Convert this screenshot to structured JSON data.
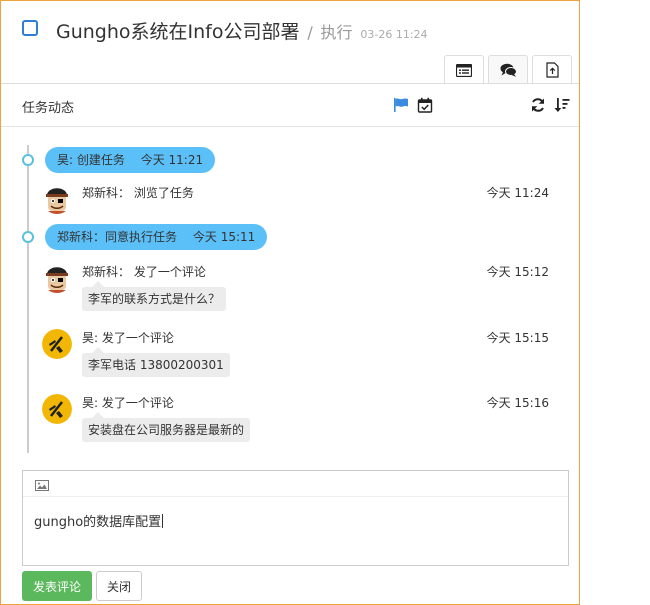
{
  "task": {
    "title": "Gungho系统在Info公司部署",
    "separator": "/",
    "status": "执行",
    "timestamp": "03-26 11:24"
  },
  "tabs": [
    {
      "icon": "list-icon",
      "active": false
    },
    {
      "icon": "comments-icon",
      "active": true
    },
    {
      "icon": "file-upload-icon",
      "active": false
    }
  ],
  "toolbar": {
    "title": "任务动态",
    "icons": [
      "flag-icon",
      "calendar-check-icon",
      "refresh-icon",
      "sort-icon"
    ],
    "flag_color": "#3b8be0"
  },
  "events": [
    {
      "actor": "昊",
      "action": "创建任务",
      "time": "今天 11:21"
    },
    {
      "actor": "郑新科",
      "action": "同意执行任务",
      "time": "今天 15:11"
    }
  ],
  "entries": [
    {
      "who": "郑新科：  浏览了任务",
      "time": "今天 11:24",
      "comment": "",
      "avatar": "pirate-avatar"
    },
    {
      "who": "郑新科：  发了一个评论",
      "time": "今天 15:12",
      "comment": "李军的联系方式是什么？",
      "avatar": "pirate-avatar"
    },
    {
      "who": "昊:  发了一个评论",
      "time": "今天 15:15",
      "comment": "李军电话 13800200301",
      "avatar": "sun-avatar"
    },
    {
      "who": "昊:  发了一个评论",
      "time": "今天 15:16",
      "comment": "安装盘在公司服务器是最新的",
      "avatar": "sun-avatar"
    }
  ],
  "editor": {
    "text": "gungho的数据库配置",
    "image_icon": "image-icon"
  },
  "buttons": {
    "post": "发表评论",
    "close": "关闭"
  },
  "colors": {
    "accent": "#5bc0f8",
    "primary_button": "#5cb85c",
    "panel_border": "#f0a23b"
  }
}
